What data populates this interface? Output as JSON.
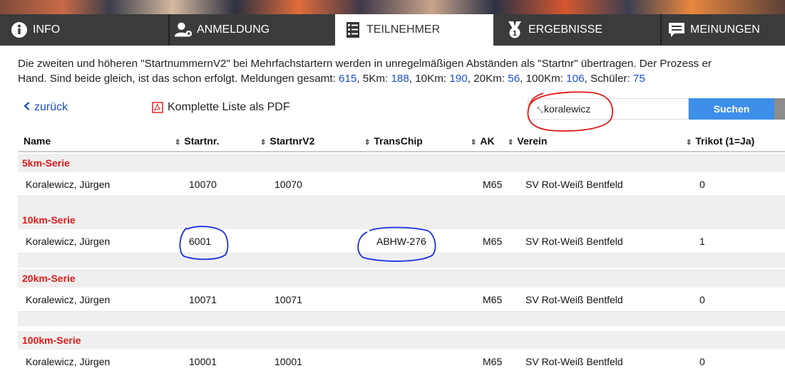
{
  "nav": {
    "tabs": [
      {
        "label": "INFO",
        "icon": "info-icon"
      },
      {
        "label": "ANMELDUNG",
        "icon": "add-user-icon"
      },
      {
        "label": "TEILNEHMER",
        "icon": "list-icon"
      },
      {
        "label": "ERGEBNISSE",
        "icon": "medal-icon"
      },
      {
        "label": "MEINUNGEN",
        "icon": "comment-icon"
      }
    ]
  },
  "info": {
    "line1": "Die zweiten und höheren \"StartnummernV2\" bei Mehrfachstartern werden in unregelmäßigen Abständen als \"Startnr\" übertragen. Der Prozess er",
    "line2_prefix": "Hand. Sind beide gleich, ist das schon erfolgt. Meldungen gesamt: ",
    "total": "615",
    "sep1": ", 5Km: ",
    "km5": "188",
    "sep2": ", 10Km: ",
    "km10": "190",
    "sep3": ", 20Km: ",
    "km20": "56",
    "sep4": ", 100Km: ",
    "km100": "106",
    "sep5": ", Schüler: ",
    "schueler": "75"
  },
  "toolbar": {
    "back_label": "zurück",
    "pdf_label": "Komplette Liste als PDF",
    "search_value": "koralewicz",
    "search_button": "Suchen"
  },
  "table": {
    "columns": [
      "Name",
      "Startnr.",
      "StartnrV2",
      "TransChip",
      "AK",
      "Verein",
      "Trikot (1=Ja)"
    ],
    "groups": [
      {
        "title": "5km-Serie",
        "rows": [
          {
            "name": "Koralewicz, Jürgen",
            "startnr": "10070",
            "startnrv2": "10070",
            "transchip": "",
            "ak": "M65",
            "verein": "SV Rot-Weiß Bentfeld",
            "trikot": "0"
          }
        ]
      },
      {
        "title": "10km-Serie",
        "rows": [
          {
            "name": "Koralewicz, Jürgen",
            "startnr": "6001",
            "startnrv2": "",
            "transchip": "ABHW-276",
            "ak": "M65",
            "verein": "SV Rot-Weiß Bentfeld",
            "trikot": "1"
          }
        ]
      },
      {
        "title": "20km-Serie",
        "rows": [
          {
            "name": "Koralewicz, Jürgen",
            "startnr": "10071",
            "startnrv2": "10071",
            "transchip": "",
            "ak": "M65",
            "verein": "SV Rot-Weiß Bentfeld",
            "trikot": "0"
          }
        ]
      },
      {
        "title": "100km-Serie",
        "rows": [
          {
            "name": "Koralewicz, Jürgen",
            "startnr": "10001",
            "startnrv2": "10001",
            "transchip": "",
            "ak": "M65",
            "verein": "SV Rot-Weiß Bentfeld",
            "trikot": "0"
          }
        ]
      }
    ]
  },
  "colors": {
    "nav_bg": "#3b3b3b",
    "link": "#1a4fd1",
    "group_title": "#e11b1b",
    "search_button": "#3d8fea",
    "annotation_red": "#e01818",
    "annotation_blue": "#1a2fe0"
  }
}
